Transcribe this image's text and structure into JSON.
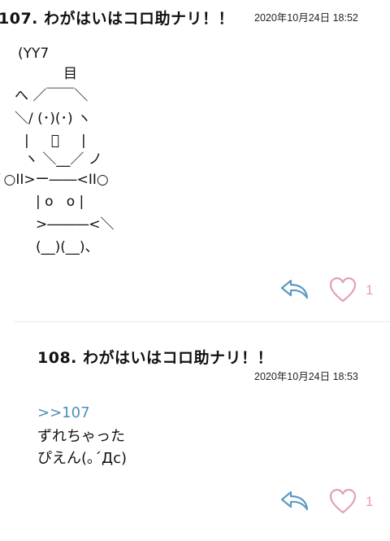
{
  "posts": [
    {
      "number": "107.",
      "title": "わがはいはコロ助ナリ！！",
      "date": "2020年10月24日 18:52",
      "aa": [
        "(YY7",
        "目",
        "へ ／￣￣＼",
        "＼/ (･)(･) ヽ",
        "|     ﾟ     |",
        "ヽ ＼__／ ノ",
        "ﾞ○II>ー――<II○",
        "| o   o |",
        ">―――<＼",
        "(__)(__)、"
      ],
      "like_count": "1"
    },
    {
      "number": "108.",
      "title": "わがはいはコロ助ナリ！！",
      "date": "2020年10月24日 18:53",
      "anchor": ">>107",
      "lines": [
        "ずれちゃった",
        "ぴえん(｡´Дc)"
      ],
      "like_count": "1"
    }
  ],
  "colors": {
    "reply_icon": "#5b9ac4",
    "like_icon": "#e49fb6",
    "anchor": "#4a90b8"
  },
  "icons": {
    "reply": "reply-arrow-icon",
    "like": "heart-outline-icon"
  }
}
